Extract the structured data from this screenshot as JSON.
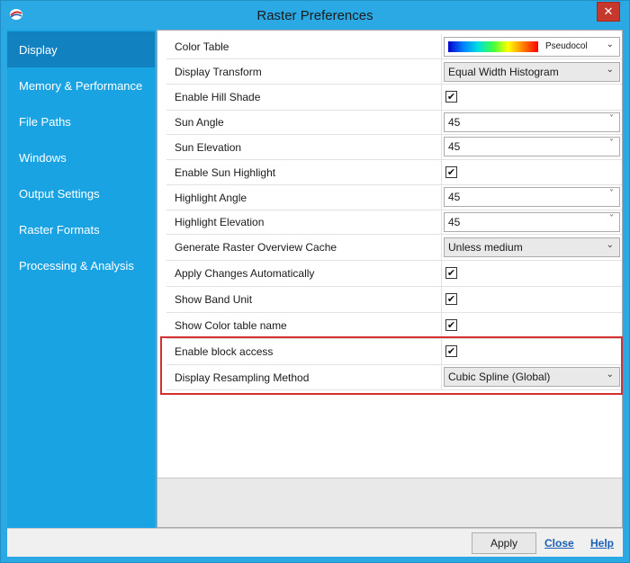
{
  "window": {
    "title": "Raster Preferences",
    "close_glyph": "✕"
  },
  "sidebar": {
    "items": [
      {
        "label": "Display",
        "active": true
      },
      {
        "label": "Memory & Performance"
      },
      {
        "label": "File Paths"
      },
      {
        "label": "Windows"
      },
      {
        "label": "Output Settings"
      },
      {
        "label": "Raster Formats"
      },
      {
        "label": "Processing & Analysis"
      }
    ]
  },
  "settings": {
    "color_table": {
      "label": "Color Table",
      "value": "Pseudocol"
    },
    "display_transform": {
      "label": "Display Transform",
      "value": "Equal Width Histogram"
    },
    "enable_hill_shade": {
      "label": "Enable Hill Shade",
      "checked": true
    },
    "sun_angle": {
      "label": "Sun Angle",
      "value": "45"
    },
    "sun_elevation": {
      "label": "Sun Elevation",
      "value": "45"
    },
    "enable_sun_highlight": {
      "label": "Enable Sun Highlight",
      "checked": true
    },
    "highlight_angle": {
      "label": "Highlight Angle",
      "value": "45"
    },
    "highlight_elevation": {
      "label": "Highlight Elevation",
      "value": "45"
    },
    "overview_cache": {
      "label": "Generate Raster Overview Cache",
      "value": "Unless medium"
    },
    "apply_auto": {
      "label": "Apply Changes Automatically",
      "checked": true
    },
    "show_band_unit": {
      "label": "Show Band Unit",
      "checked": true
    },
    "show_color_table_name": {
      "label": "Show Color table name",
      "checked": true
    },
    "enable_block_access": {
      "label": "Enable block access",
      "checked": true
    },
    "resampling_method": {
      "label": "Display Resampling Method",
      "value": "Cubic Spline (Global)"
    }
  },
  "glyphs": {
    "check": "✔",
    "dropdown": "⌄",
    "spin": "˅"
  },
  "footer": {
    "apply_label": "Apply",
    "close_label": "Close",
    "help_label": "Help"
  },
  "colors": {
    "accent": "#2aa9e5",
    "sidebar_active": "#1182bf",
    "highlight_border": "#d32f2f",
    "link": "#1a5fb4"
  }
}
